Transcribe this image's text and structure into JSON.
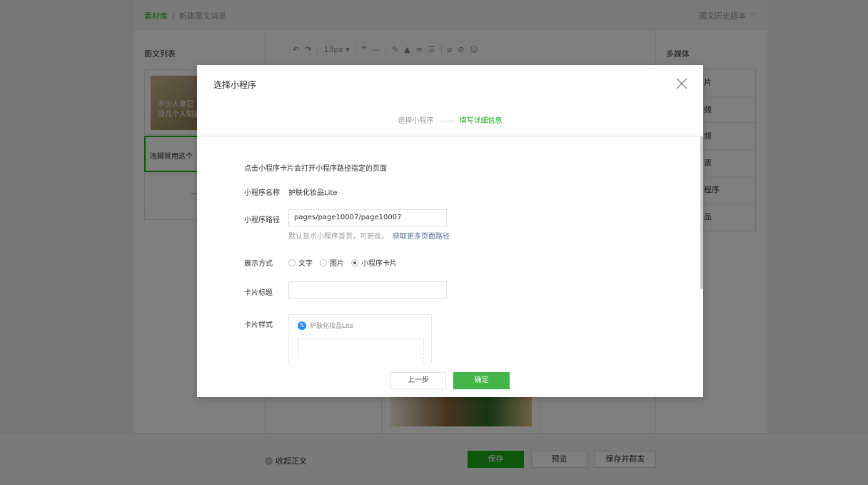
{
  "breadcrumb": {
    "root": "素材库",
    "separator": "/",
    "current": "新建图文消息"
  },
  "history_label": "图文历史版本",
  "article_list": {
    "title": "图文列表",
    "cover_text_line1": "不少人拿它",
    "cover_text_line2": "没几个人知道",
    "item_text": "泡脚就用这个",
    "add_symbol": "—"
  },
  "toolbar": {
    "font_size": "13px"
  },
  "media": {
    "title": "多媒体",
    "items": [
      "片",
      "频",
      "频",
      "票",
      "程序",
      "品"
    ]
  },
  "footer": {
    "collapse_label": "收起正文",
    "save_label": "保存",
    "preview_label": "预览",
    "save_send_label": "保存并群发"
  },
  "modal": {
    "title": "选择小程序",
    "steps": {
      "step1": "选择小程序",
      "step2": "填写详细信息"
    },
    "hint": "点击小程序卡片会打开小程序路径指定的页面",
    "name_label": "小程序名称",
    "name_value": "护肤化妆品Lite",
    "path_label": "小程序路径",
    "path_value": "pages/page10007/page10007",
    "path_help": "默认显示小程序首页，可更改。",
    "path_help_link": "获取更多页面路径",
    "display_label": "展示方式",
    "display_options": [
      "文字",
      "图片",
      "小程序卡片"
    ],
    "display_selected": "小程序卡片",
    "card_title_label": "卡片标题",
    "card_title_value": "",
    "card_style_label": "卡片样式",
    "card_app_name": "护肤化妆品Lite",
    "back_label": "上一步",
    "ok_label": "确定"
  },
  "colors": {
    "accent": "#1aad19",
    "link": "#576b95",
    "ok_button": "#44b549"
  }
}
